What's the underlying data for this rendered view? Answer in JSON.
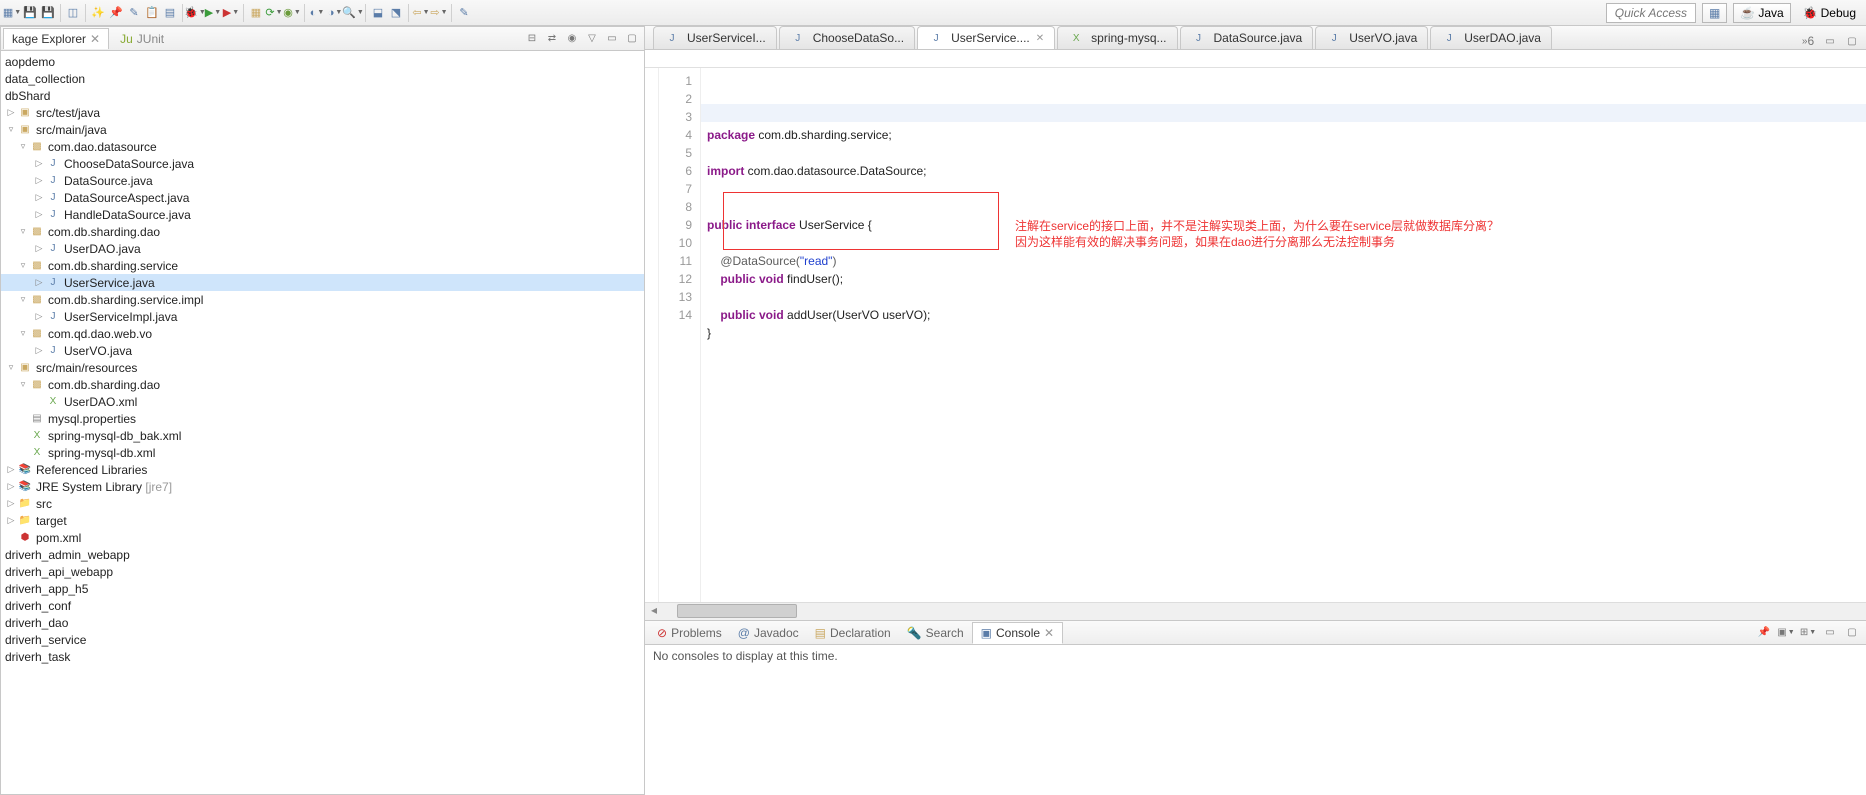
{
  "toolbar": {
    "quick_access": "Quick Access",
    "perspective_java": "Java",
    "perspective_debug": "Debug"
  },
  "explorer": {
    "tab_main": "kage Explorer",
    "tab_junit": "JUnit",
    "projects": [
      "aopdemo",
      "data_collection",
      "dbShard"
    ],
    "src_test": "src/test/java",
    "src_main": "src/main/java",
    "pkg_datasource": "com.dao.datasource",
    "files_datasource": [
      "ChooseDataSource.java",
      "DataSource.java",
      "DataSourceAspect.java",
      "HandleDataSource.java"
    ],
    "pkg_sharding_dao": "com.db.sharding.dao",
    "files_sharding_dao": [
      "UserDAO.java"
    ],
    "pkg_sharding_service": "com.db.sharding.service",
    "files_sharding_service": [
      "UserService.java"
    ],
    "pkg_sharding_service_impl": "com.db.sharding.service.impl",
    "files_sharding_service_impl": [
      "UserServiceImpl.java"
    ],
    "pkg_qd_vo": "com.qd.dao.web.vo",
    "files_qd_vo": [
      "UserVO.java"
    ],
    "src_resources": "src/main/resources",
    "pkg_res_dao": "com.db.sharding.dao",
    "files_res_dao": [
      "UserDAO.xml"
    ],
    "res_files": [
      "mysql.properties",
      "spring-mysql-db_bak.xml",
      "spring-mysql-db.xml"
    ],
    "ref_lib": "Referenced Libraries",
    "jre": "JRE System Library",
    "jre_suffix": "[jre7]",
    "src_folder": "src",
    "target_folder": "target",
    "pom": "pom.xml",
    "other_projects": [
      "driverh_admin_webapp",
      "driverh_api_webapp",
      "driverh_app_h5",
      "driverh_conf",
      "driverh_dao",
      "driverh_service",
      "driverh_task"
    ]
  },
  "editor": {
    "tabs": [
      {
        "label": "UserServiceI...",
        "icon": "J"
      },
      {
        "label": "ChooseDataSo...",
        "icon": "J"
      },
      {
        "label": "UserService....",
        "icon": "J",
        "active": true,
        "closable": true
      },
      {
        "label": "spring-mysq...",
        "icon": "X"
      },
      {
        "label": "DataSource.java",
        "icon": "J"
      },
      {
        "label": "UserVO.java",
        "icon": "J"
      },
      {
        "label": "UserDAO.java",
        "icon": "J"
      }
    ],
    "more_tabs": "6",
    "lines": [
      "1",
      "2",
      "3",
      "4",
      "5",
      "6",
      "7",
      "8",
      "9",
      "10",
      "11",
      "12",
      "13",
      "14"
    ],
    "code": {
      "l2_kw": "package",
      "l2_rest": " com.db.sharding.service;",
      "l4_kw": "import",
      "l4_rest": " com.dao.datasource.DataSource;",
      "l7_kw1": "public",
      "l7_kw2": "interface",
      "l7_rest": " UserService {",
      "l9_ann": "    @DataSource(",
      "l9_str": "\"read\"",
      "l9_end": ")",
      "l10_kw1": "    public",
      "l10_kw2": " void",
      "l10_rest": " findUser();",
      "l12_kw1": "    public",
      "l12_kw2": " void",
      "l12_rest": " addUser(UserVO userVO);",
      "l13": "}"
    },
    "annotation1": "注解在service的接口上面，并不是注解实现类上面，为什么要在service层就做数据库分离？",
    "annotation2": "因为这样能有效的解决事务问题，如果在dao进行分离那么无法控制事务"
  },
  "console": {
    "tabs": [
      "Problems",
      "Javadoc",
      "Declaration",
      "Search",
      "Console"
    ],
    "active_tab": "Console",
    "body": "No consoles to display at this time."
  }
}
